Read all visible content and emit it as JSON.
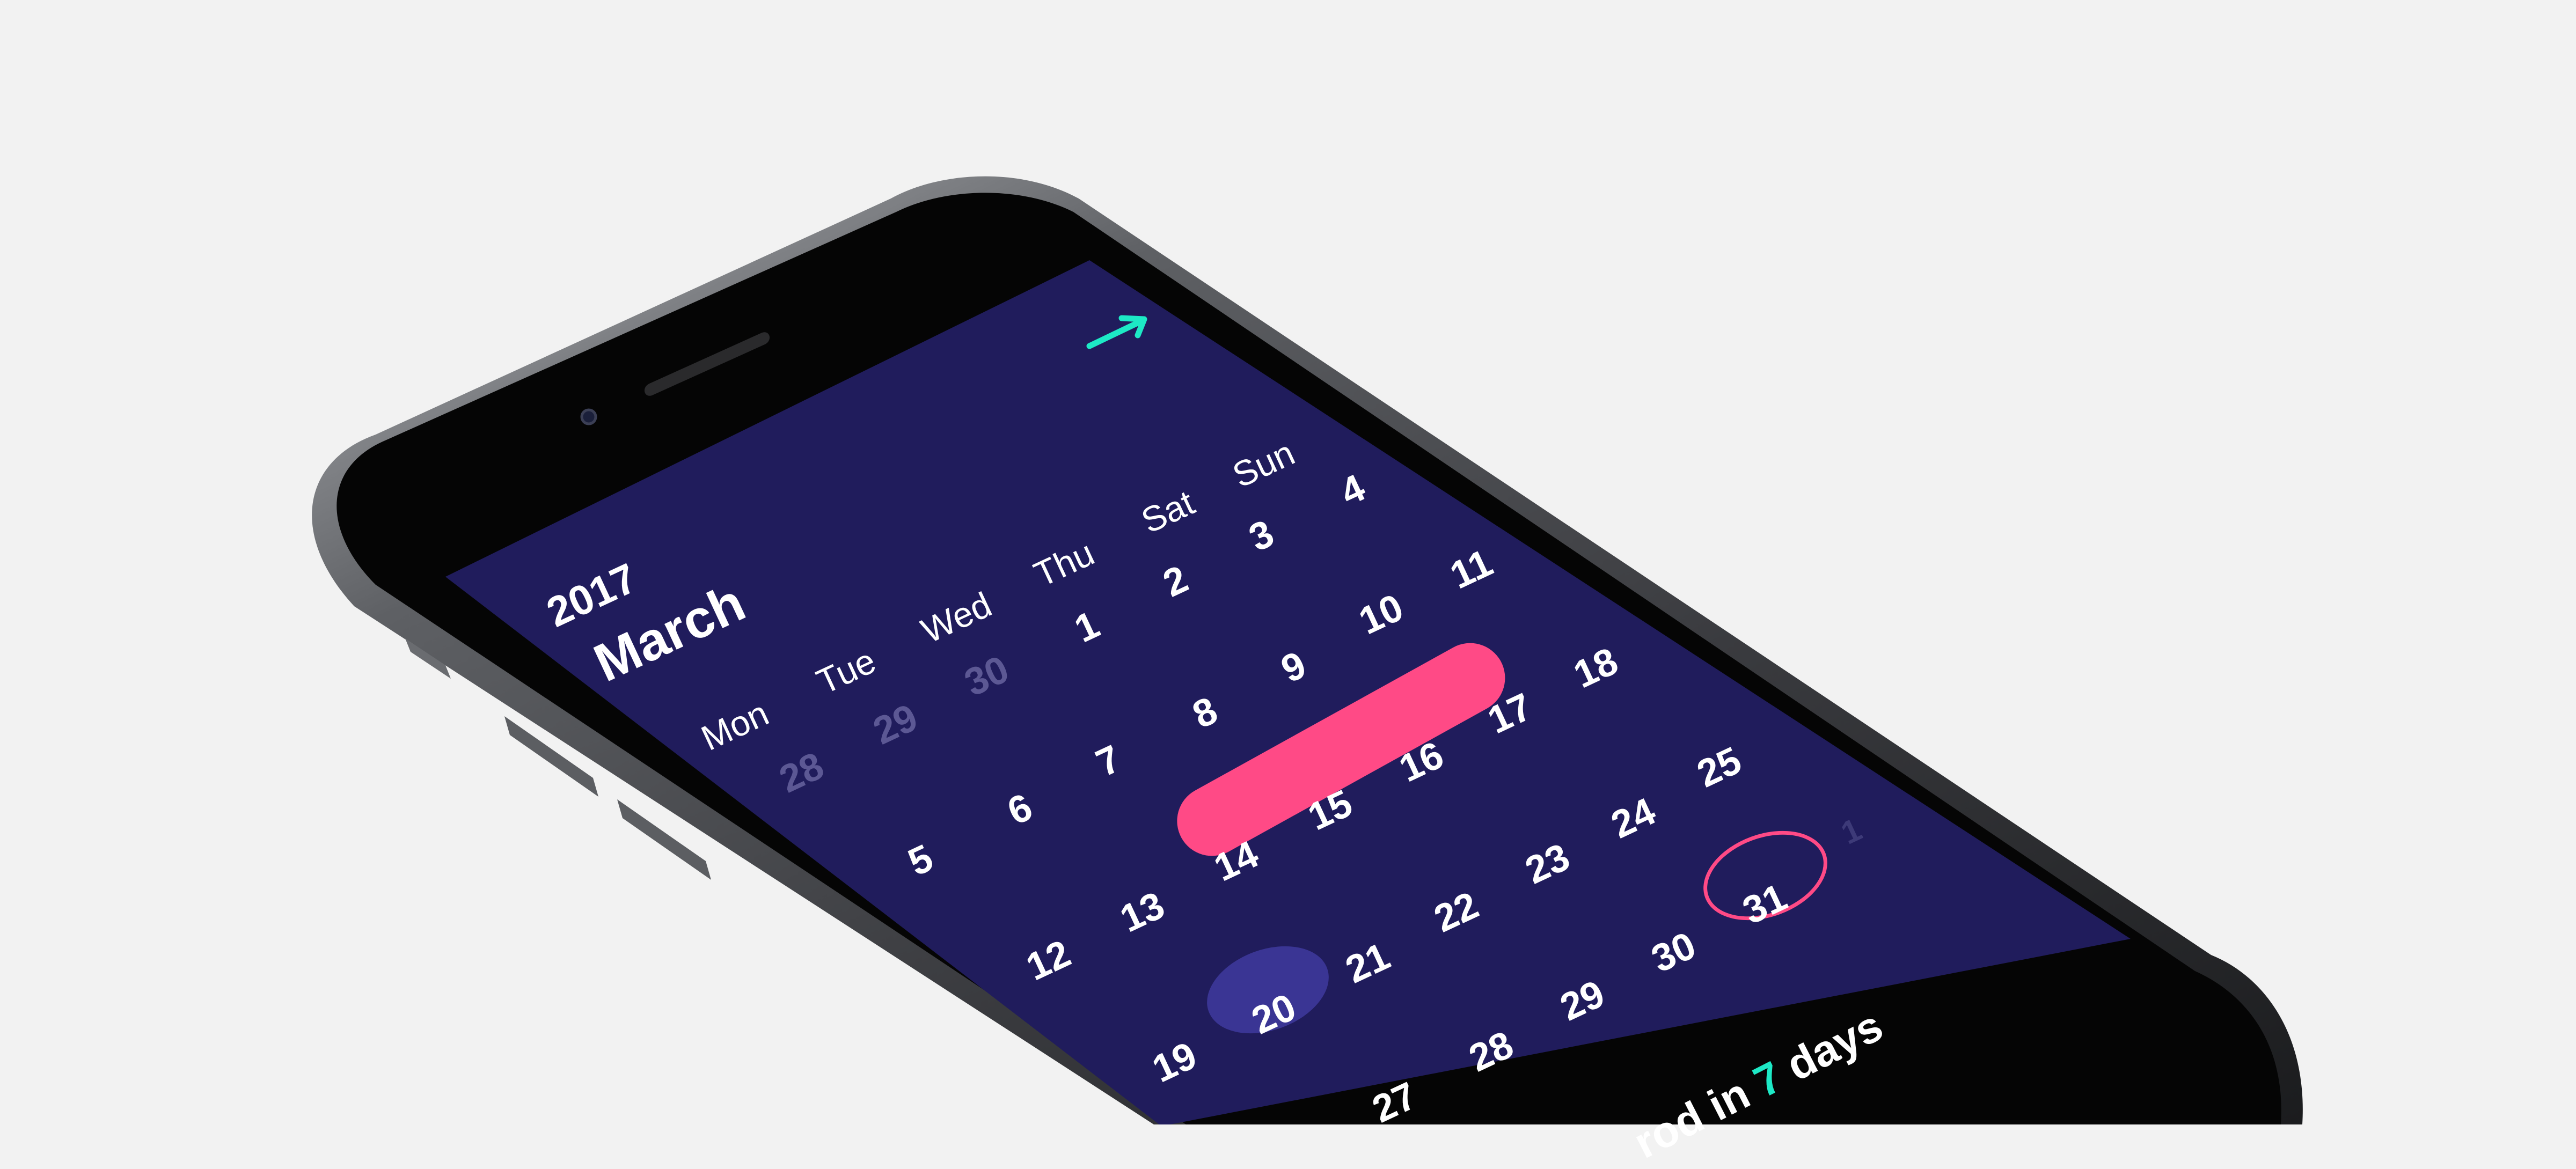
{
  "app": {
    "year": "2017",
    "month": "March",
    "next_icon": "arrow-up-right-icon"
  },
  "colors": {
    "screen_bg": "#201c5c",
    "accent_pink": "#ff4a86",
    "accent_teal": "#1de9c6",
    "today_bg": "#3a3594",
    "muted_text": "#5c5894"
  },
  "weekdays": [
    "Mon",
    "Tue",
    "Wed",
    "Thu",
    "Sat",
    "Sun"
  ],
  "days": {
    "row1": [
      "28",
      "29",
      "30",
      "1",
      "2",
      "3",
      "4"
    ],
    "row2": [
      "5",
      "6",
      "7",
      "8",
      "9",
      "10",
      "11"
    ],
    "row3": [
      "12",
      "13",
      "14",
      "15",
      "16",
      "17",
      "18"
    ],
    "row4": [
      "19",
      "20",
      "21",
      "22",
      "23",
      "24",
      "25"
    ],
    "row5": [
      "27",
      "28",
      "29",
      "30",
      "31",
      "1"
    ]
  },
  "footer": {
    "prefix": "rod in ",
    "count": "7",
    "suffix": " days"
  }
}
